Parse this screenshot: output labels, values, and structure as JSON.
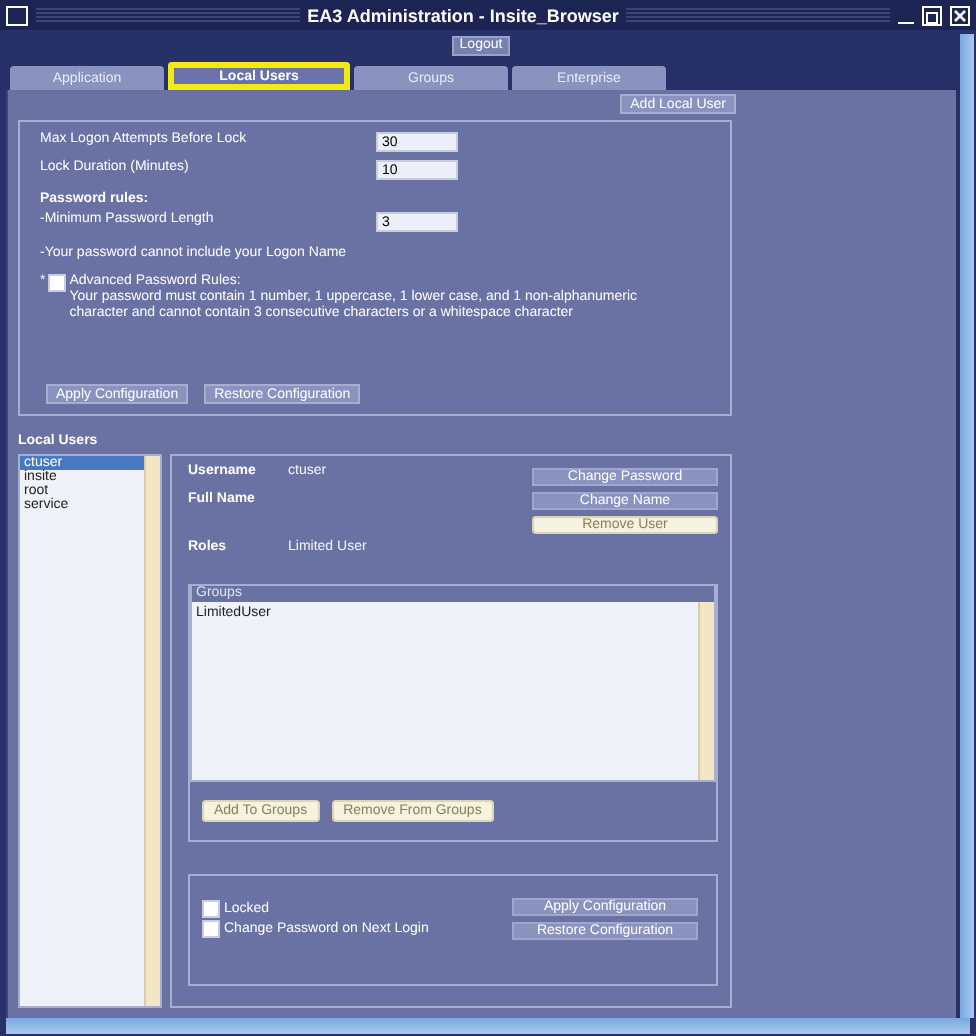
{
  "window": {
    "title": "EA3 Administration - Insite_Browser"
  },
  "logout_button": "Logout",
  "tabs": [
    {
      "label": "Application",
      "selected": false,
      "highlighted": false
    },
    {
      "label": "Local Users",
      "selected": true,
      "highlighted": true
    },
    {
      "label": "Groups",
      "selected": false,
      "highlighted": false
    },
    {
      "label": "Enterprise",
      "selected": false,
      "highlighted": false
    }
  ],
  "add_local_user_button": "Add Local User",
  "lock_settings": {
    "fields": [
      {
        "label": "Max Logon Attempts Before Lock",
        "value": "30"
      },
      {
        "label": "Lock Duration (Minutes)",
        "value": "10"
      }
    ],
    "password_rules": {
      "heading": "Password rules:",
      "min_length": {
        "label": "-Minimum Password Length",
        "value": "3"
      },
      "rule_text": "-Your password cannot include your Logon Name",
      "advanced": {
        "marker": "*",
        "label": "Advanced Password Rules:",
        "checked": false,
        "description": "Your password must contain 1 number, 1 uppercase, 1 lower case, and 1 non-alphanumeric character and cannot contain 3 consecutive characters or a whitespace character"
      }
    },
    "buttons": [
      "Apply Configuration",
      "Restore Configuration"
    ]
  },
  "local_users": {
    "heading": "Local Users",
    "users": [
      {
        "name": "ctuser",
        "selected": true
      },
      {
        "name": "insite",
        "selected": false
      },
      {
        "name": "root",
        "selected": false
      },
      {
        "name": "service",
        "selected": false
      }
    ],
    "details": {
      "fields": [
        {
          "label": "Username",
          "value": "ctuser"
        },
        {
          "label": "Full Name"
        },
        {
          "label": "Roles",
          "value": "Limited User"
        }
      ],
      "buttons": [
        {
          "label": "Change Password",
          "disabled": false
        },
        {
          "label": "Change Name",
          "disabled": false
        },
        {
          "label": "Remove User",
          "disabled": true
        }
      ],
      "groups": {
        "heading": "Groups",
        "items": [
          "LimitedUser"
        ]
      },
      "group_buttons": [
        {
          "label": "Add To Groups",
          "disabled": true
        },
        {
          "label": "Remove From Groups",
          "disabled": true
        }
      ],
      "options": [
        {
          "label": "Locked",
          "checked": false
        },
        {
          "label": "Change Password on Next Login",
          "checked": false
        }
      ],
      "option_buttons": [
        "Apply Configuration",
        "Restore Configuration"
      ]
    }
  }
}
